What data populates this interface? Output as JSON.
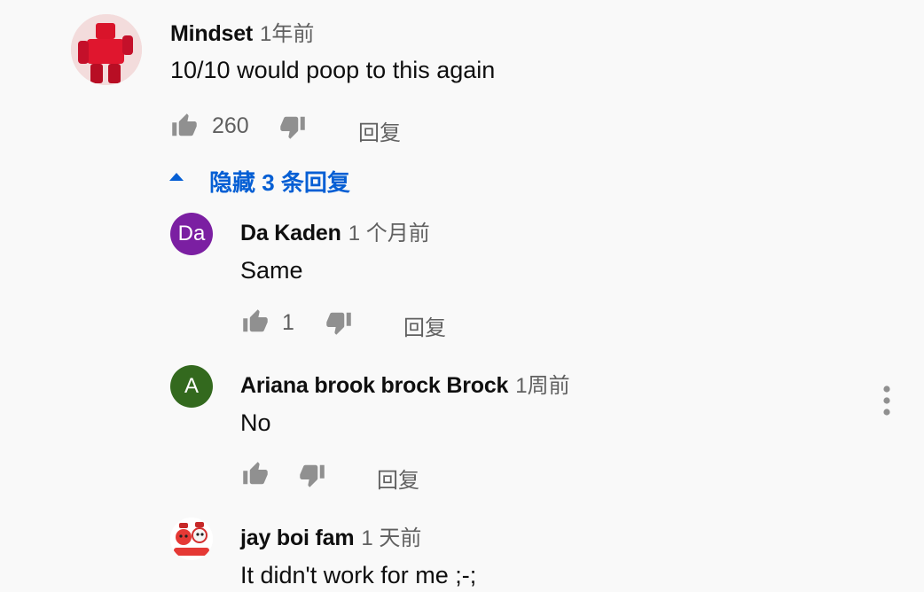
{
  "comments": {
    "top": {
      "author": "Mindset",
      "time": "1年前",
      "text": "10/10 would poop to this again",
      "likes": "260",
      "reply_label": "回复",
      "avatar_icon": "red-robot-avatar"
    },
    "toggle": {
      "label": "隐藏 3 条回复",
      "icon": "caret-up-icon",
      "color": "#065fd4"
    },
    "replies": [
      {
        "author": "Da Kaden",
        "time": "1 个月前",
        "text": "Same",
        "likes": "1",
        "reply_label": "回复",
        "avatar_letter": "Da",
        "avatar_color": "#7b1fa2"
      },
      {
        "author": "Ariana brook brock Brock",
        "time": "1周前",
        "text": "No",
        "likes": "",
        "reply_label": "回复",
        "avatar_letter": "A",
        "avatar_color": "#33691e"
      },
      {
        "author": "jay boi fam",
        "time": "1 天前",
        "text": "It didn't work for me ;-;",
        "avatar_icon": "cartoon-avatar"
      }
    ]
  },
  "colors": {
    "background": "#f9f9f9",
    "secondary_text": "#606060",
    "icon_gray": "#909090"
  }
}
